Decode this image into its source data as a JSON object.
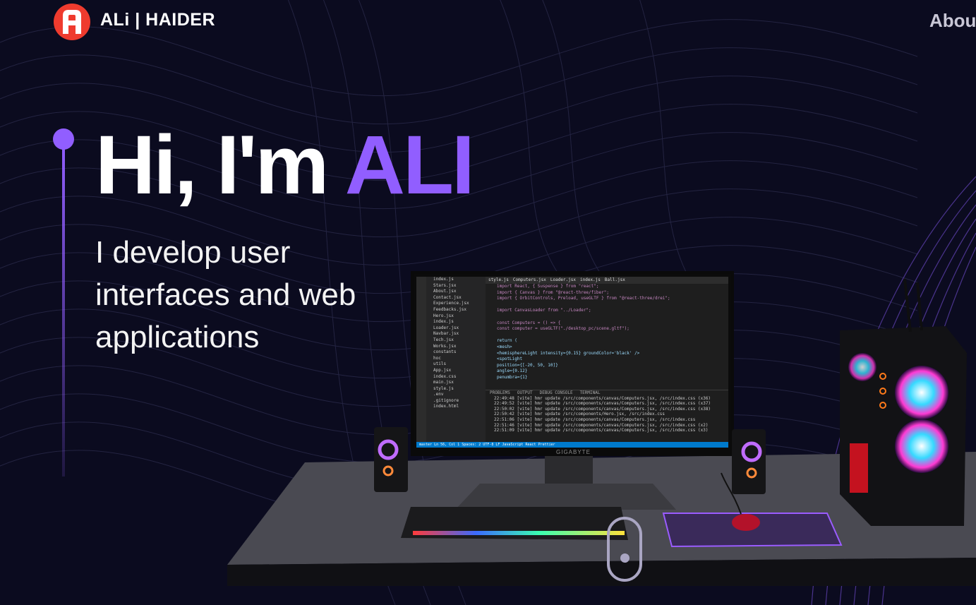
{
  "header": {
    "brand": "ALi  | HAIDER",
    "nav_link": "Abou",
    "logo_icon": "logo-a-icon"
  },
  "hero": {
    "greeting": "Hi, I'm ",
    "name": "ALI",
    "subtitle": "I develop user interfaces and web applications"
  },
  "colors": {
    "background": "#0b0b1f",
    "accent": "#915eff",
    "logo_red": "#ef3b2e",
    "nav_text": "#c9c7d6"
  },
  "monitor": {
    "brand": "GIGABYTE",
    "tabs": [
      "style.js",
      "Computers.jsx",
      "Loader.jsx",
      "index.js",
      "Ball.jsx"
    ],
    "explorer_items": [
      "index.js",
      "Stars.jsx",
      "About.jsx",
      "Contact.jsx",
      "Experience.jsx",
      "Feedbacks.jsx",
      "Hero.jsx",
      "index.js",
      "Loader.jsx",
      "Navbar.jsx",
      "Tech.jsx",
      "Works.jsx",
      "constants",
      "hoc",
      "utils",
      "App.jsx",
      "index.css",
      "main.jsx",
      "style.js",
      ".env",
      ".gitignore",
      "index.html"
    ],
    "code_lines": [
      "import React, { Suspense } from \"react\";",
      "import { Canvas } from \"@react-three/fiber\";",
      "import { OrbitControls, Preload, useGLTF } from \"@react-three/drei\";",
      "",
      "import CanvasLoader from \"../Loader\";",
      "",
      "const Computers = () => {",
      "  const computer = useGLTF(\"./desktop_pc/scene.gltf\");",
      "",
      "  return (",
      "    <mesh>",
      "      <hemisphereLight intensity={0.15} groundColor='black' />",
      "      <spotLight",
      "        position={[-20, 50, 10]}",
      "        angle={0.12}",
      "        penumbra={1}"
    ],
    "terminal_tabs": [
      "PROBLEMS",
      "OUTPUT",
      "DEBUG CONSOLE",
      "TERMINAL"
    ],
    "terminal_lines": [
      "22:49:48 [vite] hmr update /src/components/canvas/Computers.jsx, /src/index.css (x36)",
      "22:49:52 [vite] hmr update /src/components/canvas/Computers.jsx, /src/index.css (x37)",
      "22:50:02 [vite] hmr update /src/components/canvas/Computers.jsx, /src/index.css (x38)",
      "22:50:42 [vite] hmr update /src/components/Hero.jsx, /src/index.css",
      "22:51:06 [vite] hmr update /src/components/canvas/Computers.jsx, /src/index.css",
      "22:51:46 [vite] hmr update /src/components/canvas/Computers.jsx, /src/index.css (x2)",
      "22:51:09 [vite] hmr update /src/components/canvas/Computers.jsx, /src/index.css (x3)"
    ],
    "status_bar": "master   Ln 56, Col 1   Spaces: 2   UTF-8   LF   JavaScript React   Prettier"
  },
  "scroll": {
    "icon": "mouse-scroll-icon"
  }
}
